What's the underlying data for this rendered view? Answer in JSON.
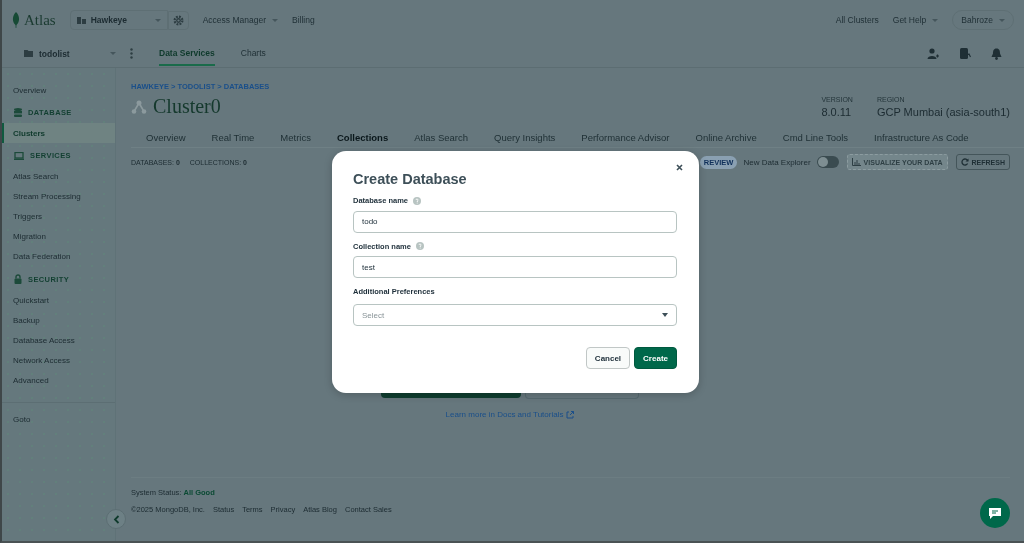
{
  "header": {
    "logo": "Atlas",
    "organization": "Hawkeye",
    "nav": [
      {
        "label": "Access Manager",
        "dropdown": true
      },
      {
        "label": "Billing",
        "dropdown": false
      }
    ],
    "right": [
      {
        "label": "All Clusters",
        "dropdown": false,
        "kind": "link"
      },
      {
        "label": "Get Help",
        "dropdown": true,
        "kind": "link"
      },
      {
        "label": "Bahroze",
        "dropdown": true,
        "kind": "user"
      }
    ]
  },
  "project_bar": {
    "project": "todolist",
    "tabs": [
      {
        "label": "Data Services",
        "selected": true
      },
      {
        "label": "Charts",
        "selected": false
      }
    ]
  },
  "sidebar": {
    "items": [
      {
        "kind": "link",
        "label": "Overview",
        "selected": false
      },
      {
        "kind": "section",
        "label": "DATABASE"
      },
      {
        "kind": "link",
        "label": "Clusters",
        "selected": true
      },
      {
        "kind": "section",
        "label": "SERVICES"
      },
      {
        "kind": "link",
        "label": "Atlas Search",
        "selected": false
      },
      {
        "kind": "link",
        "label": "Stream Processing",
        "selected": false
      },
      {
        "kind": "link",
        "label": "Triggers",
        "selected": false
      },
      {
        "kind": "link",
        "label": "Migration",
        "selected": false
      },
      {
        "kind": "link",
        "label": "Data Federation",
        "selected": false
      },
      {
        "kind": "section",
        "label": "SECURITY"
      },
      {
        "kind": "link",
        "label": "Quickstart",
        "selected": false
      },
      {
        "kind": "link",
        "label": "Backup",
        "selected": false
      },
      {
        "kind": "link",
        "label": "Database Access",
        "selected": false
      },
      {
        "kind": "link",
        "label": "Network Access",
        "selected": false
      },
      {
        "kind": "link",
        "label": "Advanced",
        "selected": false
      },
      {
        "kind": "divider"
      },
      {
        "kind": "link",
        "label": "Goto",
        "selected": false
      }
    ]
  },
  "breadcrumb": "HAWKEYE > TODOLIST > DATABASES",
  "cluster": {
    "name": "Cluster0",
    "version_label": "VERSION",
    "version": "8.0.11",
    "region_label": "REGION",
    "region": "GCP Mumbai (asia-south1)"
  },
  "tabs": [
    {
      "label": "Overview",
      "selected": false
    },
    {
      "label": "Real Time",
      "selected": false
    },
    {
      "label": "Metrics",
      "selected": false
    },
    {
      "label": "Collections",
      "selected": true
    },
    {
      "label": "Atlas Search",
      "selected": false
    },
    {
      "label": "Query Insights",
      "selected": false
    },
    {
      "label": "Performance Advisor",
      "selected": false
    },
    {
      "label": "Online Archive",
      "selected": false
    },
    {
      "label": "Cmd Line Tools",
      "selected": false
    },
    {
      "label": "Infrastructure As Code",
      "selected": false
    }
  ],
  "toolbar": {
    "databases_label": "DATABASES:",
    "databases": "0",
    "collections_label": "COLLECTIONS:",
    "collections": "0",
    "preview_badge": "REVIEW",
    "explorer_label": "New Data Explorer",
    "explorer_on": false,
    "visualize": "VISUALIZE YOUR DATA",
    "visualize_disabled": true,
    "refresh": "REFRESH"
  },
  "learn_more": "Learn more in Docs and Tutorials",
  "footer": {
    "status_label": "System Status:",
    "status": "All Good",
    "copyright": "©2025 MongoDB, Inc.",
    "links": [
      "Status",
      "Terms",
      "Privacy",
      "Atlas Blog",
      "Contact Sales"
    ]
  },
  "modal": {
    "title": "Create Database",
    "fields": [
      {
        "kind": "text",
        "label": "Database name",
        "help": true,
        "value": "todo"
      },
      {
        "kind": "text",
        "label": "Collection name",
        "help": true,
        "value": "test"
      },
      {
        "kind": "select",
        "label": "Additional Preferences",
        "help": false,
        "placeholder": "Select"
      }
    ],
    "buttons": [
      {
        "label": "Cancel",
        "kind": "secondary"
      },
      {
        "label": "Create",
        "kind": "primary"
      }
    ]
  }
}
